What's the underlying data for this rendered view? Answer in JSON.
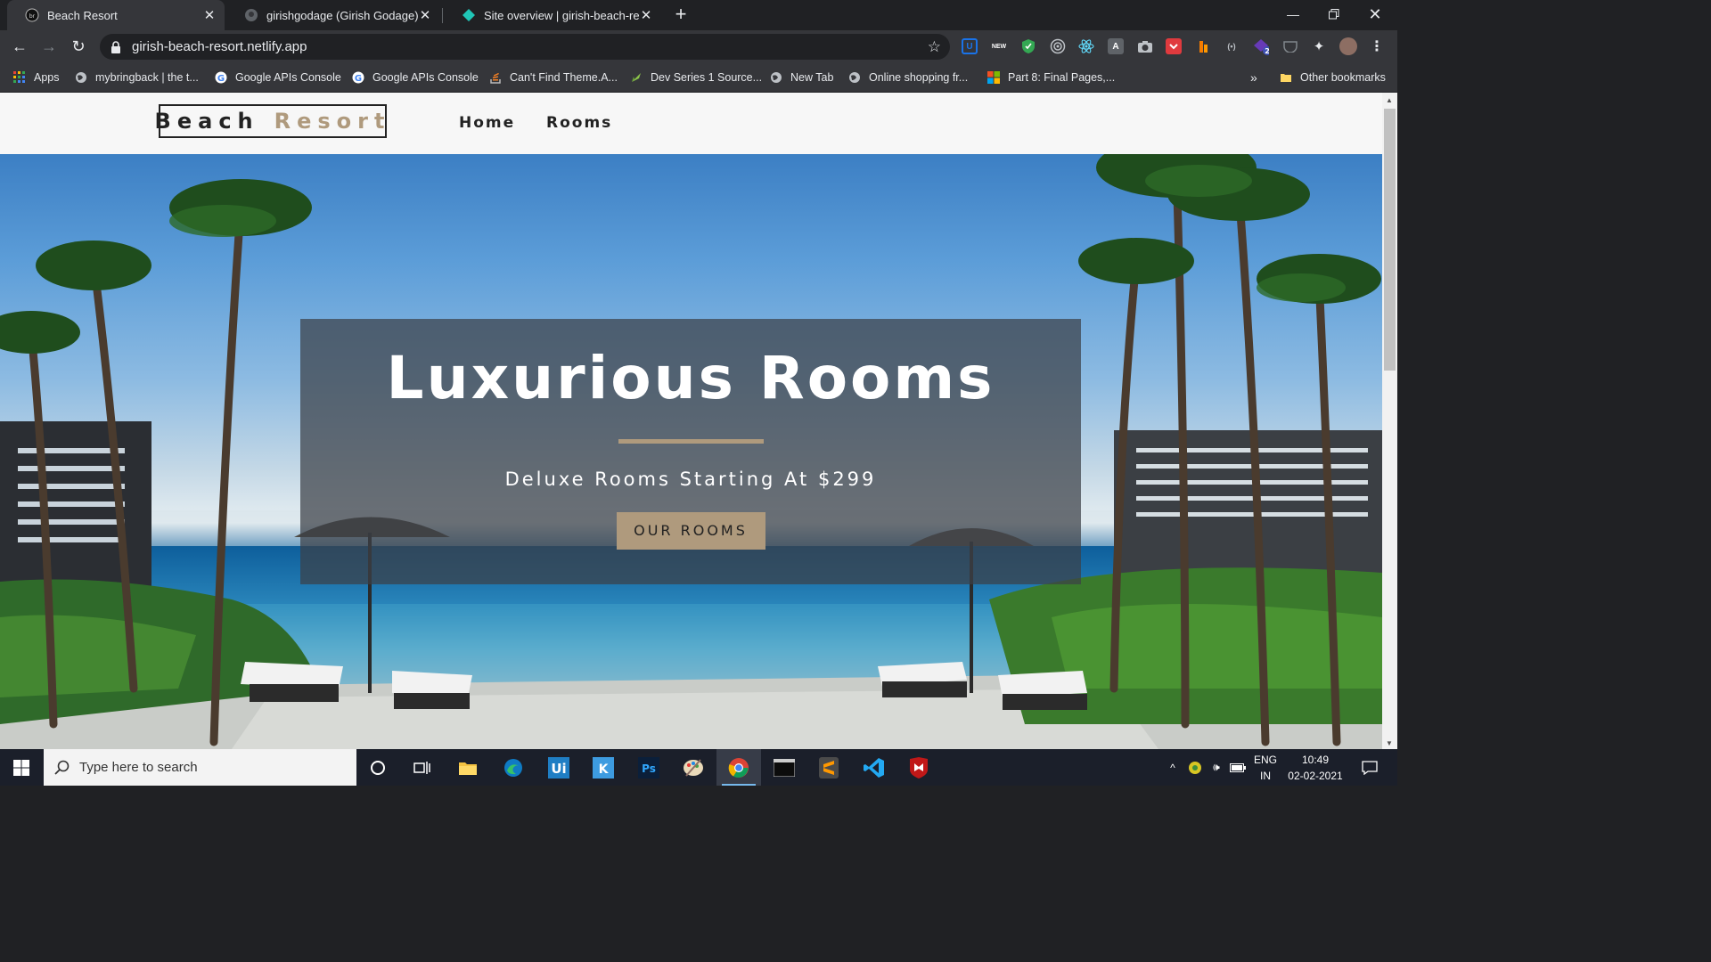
{
  "browser": {
    "tabs": [
      {
        "title": "Beach Resort",
        "active": true
      },
      {
        "title": "girishgodage (Girish Godage)",
        "active": false
      },
      {
        "title": "Site overview | girish-beach-resort",
        "active": false
      }
    ],
    "url": "girish-beach-resort.netlify.app",
    "bookmarks": [
      {
        "label": "Apps",
        "icon": "apps-grid-icon"
      },
      {
        "label": "mybringback | the t...",
        "icon": "globe-icon"
      },
      {
        "label": "Google APIs Console",
        "icon": "google-icon"
      },
      {
        "label": "Google APIs Console",
        "icon": "google-icon"
      },
      {
        "label": "Can't Find Theme.A...",
        "icon": "stackoverflow-icon"
      },
      {
        "label": "Dev Series 1 Source...",
        "icon": "rocket-icon"
      },
      {
        "label": "New Tab",
        "icon": "globe-icon"
      },
      {
        "label": "Online shopping fr...",
        "icon": "globe-icon"
      },
      {
        "label": "Part 8: Final Pages,...",
        "icon": "microsoft-icon"
      }
    ],
    "bookmarks_overflow": "»",
    "other_bookmarks": "Other bookmarks",
    "extension_badge": "2"
  },
  "site": {
    "logo": {
      "part1": "Beach",
      "part2": "Resort"
    },
    "nav": [
      "Home",
      "Rooms"
    ],
    "hero": {
      "title": "Luxurious Rooms",
      "subtitle": "Deluxe Rooms Starting At $299",
      "cta": "OUR ROOMS"
    },
    "colors": {
      "accent": "#af9a7d",
      "dark": "#222222"
    }
  },
  "taskbar": {
    "search_placeholder": "Type here to search",
    "lang": {
      "line1": "ENG",
      "line2": "IN"
    },
    "time": "10:49",
    "date": "02-02-2021"
  }
}
